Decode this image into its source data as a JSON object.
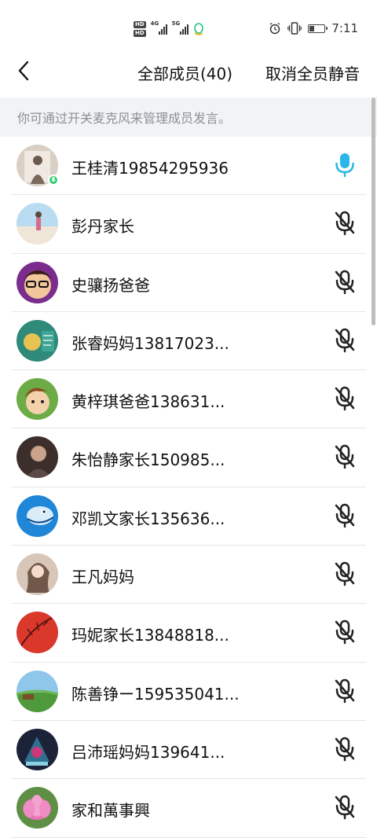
{
  "status_bar": {
    "hd1": "HD",
    "hd2": "HD",
    "gen1": "4G",
    "gen2": "5G",
    "time": "7:11"
  },
  "header": {
    "title": "全部成员(40)",
    "mute_all_label": "取消全员静音"
  },
  "hint": "你可通过开关麦克风来管理成员发言。",
  "members": [
    {
      "name": "王桂清19854295936",
      "mic": "on",
      "speaking": true
    },
    {
      "name": "彭丹家长",
      "mic": "muted"
    },
    {
      "name": "史骧扬爸爸",
      "mic": "muted"
    },
    {
      "name": "张睿妈妈13817023...",
      "mic": "muted"
    },
    {
      "name": "黄梓琪爸爸138631...",
      "mic": "muted"
    },
    {
      "name": "朱怡静家长150985...",
      "mic": "muted"
    },
    {
      "name": "邓凯文家长135636...",
      "mic": "muted"
    },
    {
      "name": "王凡妈妈",
      "mic": "muted"
    },
    {
      "name": "玛妮家长13848818...",
      "mic": "muted"
    },
    {
      "name": "陈善铮ー159535041...",
      "mic": "muted"
    },
    {
      "name": "吕沛瑶妈妈139641...",
      "mic": "muted"
    },
    {
      "name": "家和萬事興",
      "mic": "muted"
    }
  ],
  "colors": {
    "mic_on": "#29b6e8",
    "mic_muted": "#222222",
    "speaking_dot": "#2ecc71",
    "hint_bg": "#f2f3f5",
    "hint_text": "#8b8f96"
  }
}
